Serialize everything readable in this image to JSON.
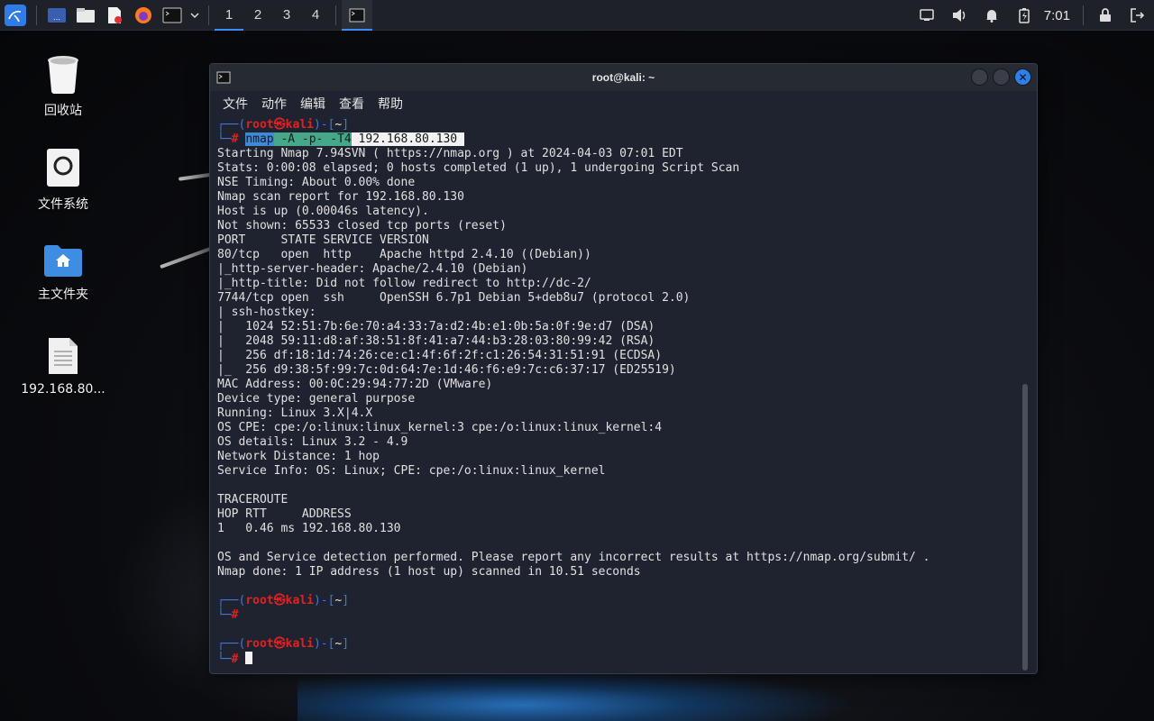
{
  "panel": {
    "workspaces": [
      "1",
      "2",
      "3",
      "4"
    ],
    "active_workspace": "1",
    "clock": "7:01",
    "accent": "#3b8cf5"
  },
  "desktop": {
    "icons": [
      {
        "label": "回收站",
        "icon": "trash-icon"
      },
      {
        "label": "文件系统",
        "icon": "filesystem-icon"
      },
      {
        "label": "主文件夹",
        "icon": "home-folder-icon"
      },
      {
        "label": "192.168.80...",
        "icon": "text-file-icon"
      }
    ]
  },
  "window": {
    "title": "root@kali: ~",
    "menu": [
      "文件",
      "动作",
      "编辑",
      "查看",
      "帮助"
    ]
  },
  "terminal": {
    "prompt": {
      "user": "root",
      "at": "㉿",
      "host": "kali",
      "dir": "~"
    },
    "command": {
      "cmd": "nmap",
      "args": [
        "-A",
        "-p-",
        "-T4"
      ],
      "target": "192.168.80.130"
    },
    "output": [
      "Starting Nmap 7.94SVN ( https://nmap.org ) at 2024-04-03 07:01 EDT",
      "Stats: 0:00:08 elapsed; 0 hosts completed (1 up), 1 undergoing Script Scan",
      "NSE Timing: About 0.00% done",
      "Nmap scan report for 192.168.80.130",
      "Host is up (0.00046s latency).",
      "Not shown: 65533 closed tcp ports (reset)",
      "PORT     STATE SERVICE VERSION",
      "80/tcp   open  http    Apache httpd 2.4.10 ((Debian))",
      "|_http-server-header: Apache/2.4.10 (Debian)",
      "|_http-title: Did not follow redirect to http://dc-2/",
      "7744/tcp open  ssh     OpenSSH 6.7p1 Debian 5+deb8u7 (protocol 2.0)",
      "| ssh-hostkey: ",
      "|   1024 52:51:7b:6e:70:a4:33:7a:d2:4b:e1:0b:5a:0f:9e:d7 (DSA)",
      "|   2048 59:11:d8:af:38:51:8f:41:a7:44:b3:28:03:80:99:42 (RSA)",
      "|   256 df:18:1d:74:26:ce:c1:4f:6f:2f:c1:26:54:31:51:91 (ECDSA)",
      "|_  256 d9:38:5f:99:7c:0d:64:7e:1d:46:f6:e9:7c:c6:37:17 (ED25519)",
      "MAC Address: 00:0C:29:94:77:2D (VMware)",
      "Device type: general purpose",
      "Running: Linux 3.X|4.X",
      "OS CPE: cpe:/o:linux:linux_kernel:3 cpe:/o:linux:linux_kernel:4",
      "OS details: Linux 3.2 - 4.9",
      "Network Distance: 1 hop",
      "Service Info: OS: Linux; CPE: cpe:/o:linux:linux_kernel",
      "",
      "TRACEROUTE",
      "HOP RTT     ADDRESS",
      "1   0.46 ms 192.168.80.130",
      "",
      "OS and Service detection performed. Please report any incorrect results at https://nmap.org/submit/ .",
      "Nmap done: 1 IP address (1 host up) scanned in 10.51 seconds"
    ]
  }
}
